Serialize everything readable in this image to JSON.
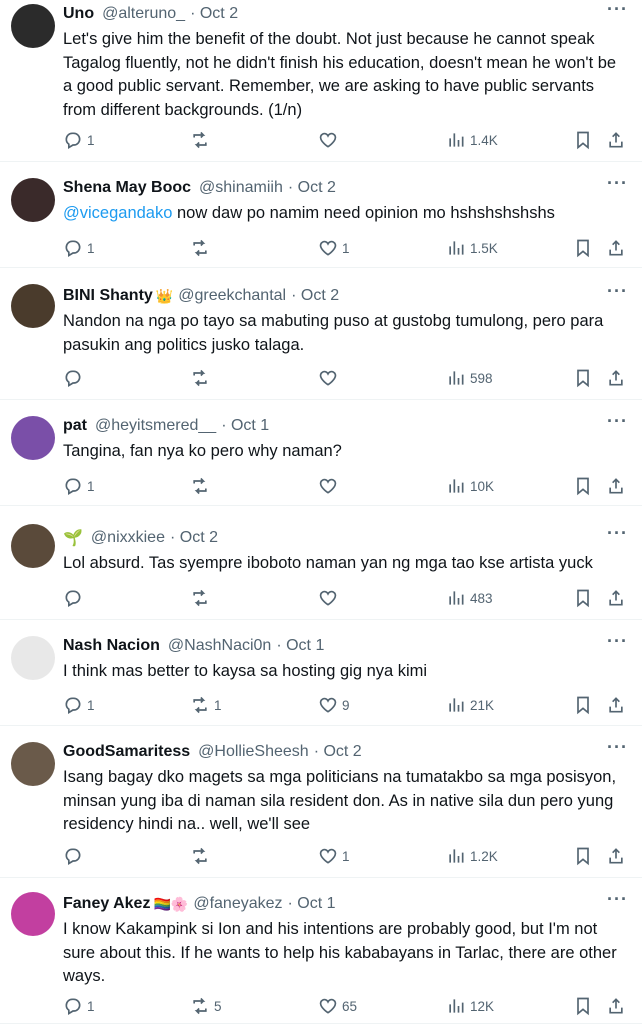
{
  "tweets": [
    {
      "name": "Uno",
      "handle": "@alteruno_",
      "date": "· Oct 2",
      "emoji": "",
      "text": "Let's give him the benefit of the doubt. Not just because he cannot speak Tagalog fluently, not he didn't finish his education, doesn't mean he won't be a good public servant. Remember, we are asking to have public servants from different backgrounds. (1/n)",
      "mention": "",
      "replies": "1",
      "retweets": "",
      "likes": "",
      "views": "1.4K",
      "avatar_color": "#2b2b2b"
    },
    {
      "name": "Shena May Booc",
      "handle": "@shinamiih",
      "date": "· Oct 2",
      "emoji": "",
      "mention": "@vicegandako",
      "text": " now daw po namim need opinion mo hshshshshshs",
      "replies": "1",
      "retweets": "",
      "likes": "1",
      "views": "1.5K",
      "avatar_color": "#3a2a2a"
    },
    {
      "name": "BINI Shanty",
      "handle": "@greekchantal",
      "date": "· Oct 2",
      "emoji": "👑",
      "mention": "",
      "text": "Nandon na nga po tayo sa mabuting puso at gustobg tumulong, pero para pasukin ang politics jusko talaga.",
      "replies": "",
      "retweets": "",
      "likes": "",
      "views": "598",
      "avatar_color": "#4a3b2c"
    },
    {
      "name": "pat",
      "handle": "@heyitsmered__",
      "date": "· Oct 1",
      "emoji": "",
      "mention": "",
      "text": "Tangina, fan nya ko pero why naman?",
      "replies": "1",
      "retweets": "",
      "likes": "",
      "views": "10K",
      "avatar_color": "#7a4fa8"
    },
    {
      "name": "🌱",
      "handle": "@nixxkiee",
      "date": "· Oct 2",
      "emoji": "",
      "mention": "",
      "text": "Lol absurd. Tas syempre iboboto naman yan ng mga tao kse artista yuck",
      "replies": "",
      "retweets": "",
      "likes": "",
      "views": "483",
      "avatar_color": "#5a4a3a"
    },
    {
      "name": "Nash Nacion",
      "handle": "@NashNaci0n",
      "date": "· Oct 1",
      "emoji": "",
      "mention": "",
      "text": "I think mas better to kaysa sa hosting gig nya kimi",
      "replies": "1",
      "retweets": "1",
      "likes": "9",
      "views": "21K",
      "avatar_color": "#e8e8e8"
    },
    {
      "name": "GoodSamaritess",
      "handle": "@HollieSheesh",
      "date": "· Oct 2",
      "emoji": "",
      "mention": "",
      "text": "Isang bagay dko magets sa mga politicians na tumatakbo sa mga posisyon, minsan yung iba di naman sila resident don. As in native sila dun pero yung residency hindi na.. well, we'll see",
      "replies": "",
      "retweets": "",
      "likes": "1",
      "views": "1.2K",
      "avatar_color": "#6a5a4a"
    },
    {
      "name": "Faney Akez",
      "handle": "@faneyakez",
      "date": "· Oct 1",
      "emoji": "🏳️‍🌈🌸",
      "mention": "",
      "text": "I know Kakampink si Ion and his intentions are probably good, but I'm not sure about this. If he wants to help his kababayans in Tarlac, there are other ways.",
      "replies": "1",
      "retweets": "5",
      "likes": "65",
      "views": "12K",
      "avatar_color": "#c23fa0"
    }
  ],
  "icons": {
    "more": "more-icon",
    "reply": "reply-icon",
    "retweet": "retweet-icon",
    "like": "heart-icon",
    "views": "views-icon",
    "bookmark": "bookmark-icon",
    "share": "share-icon"
  }
}
